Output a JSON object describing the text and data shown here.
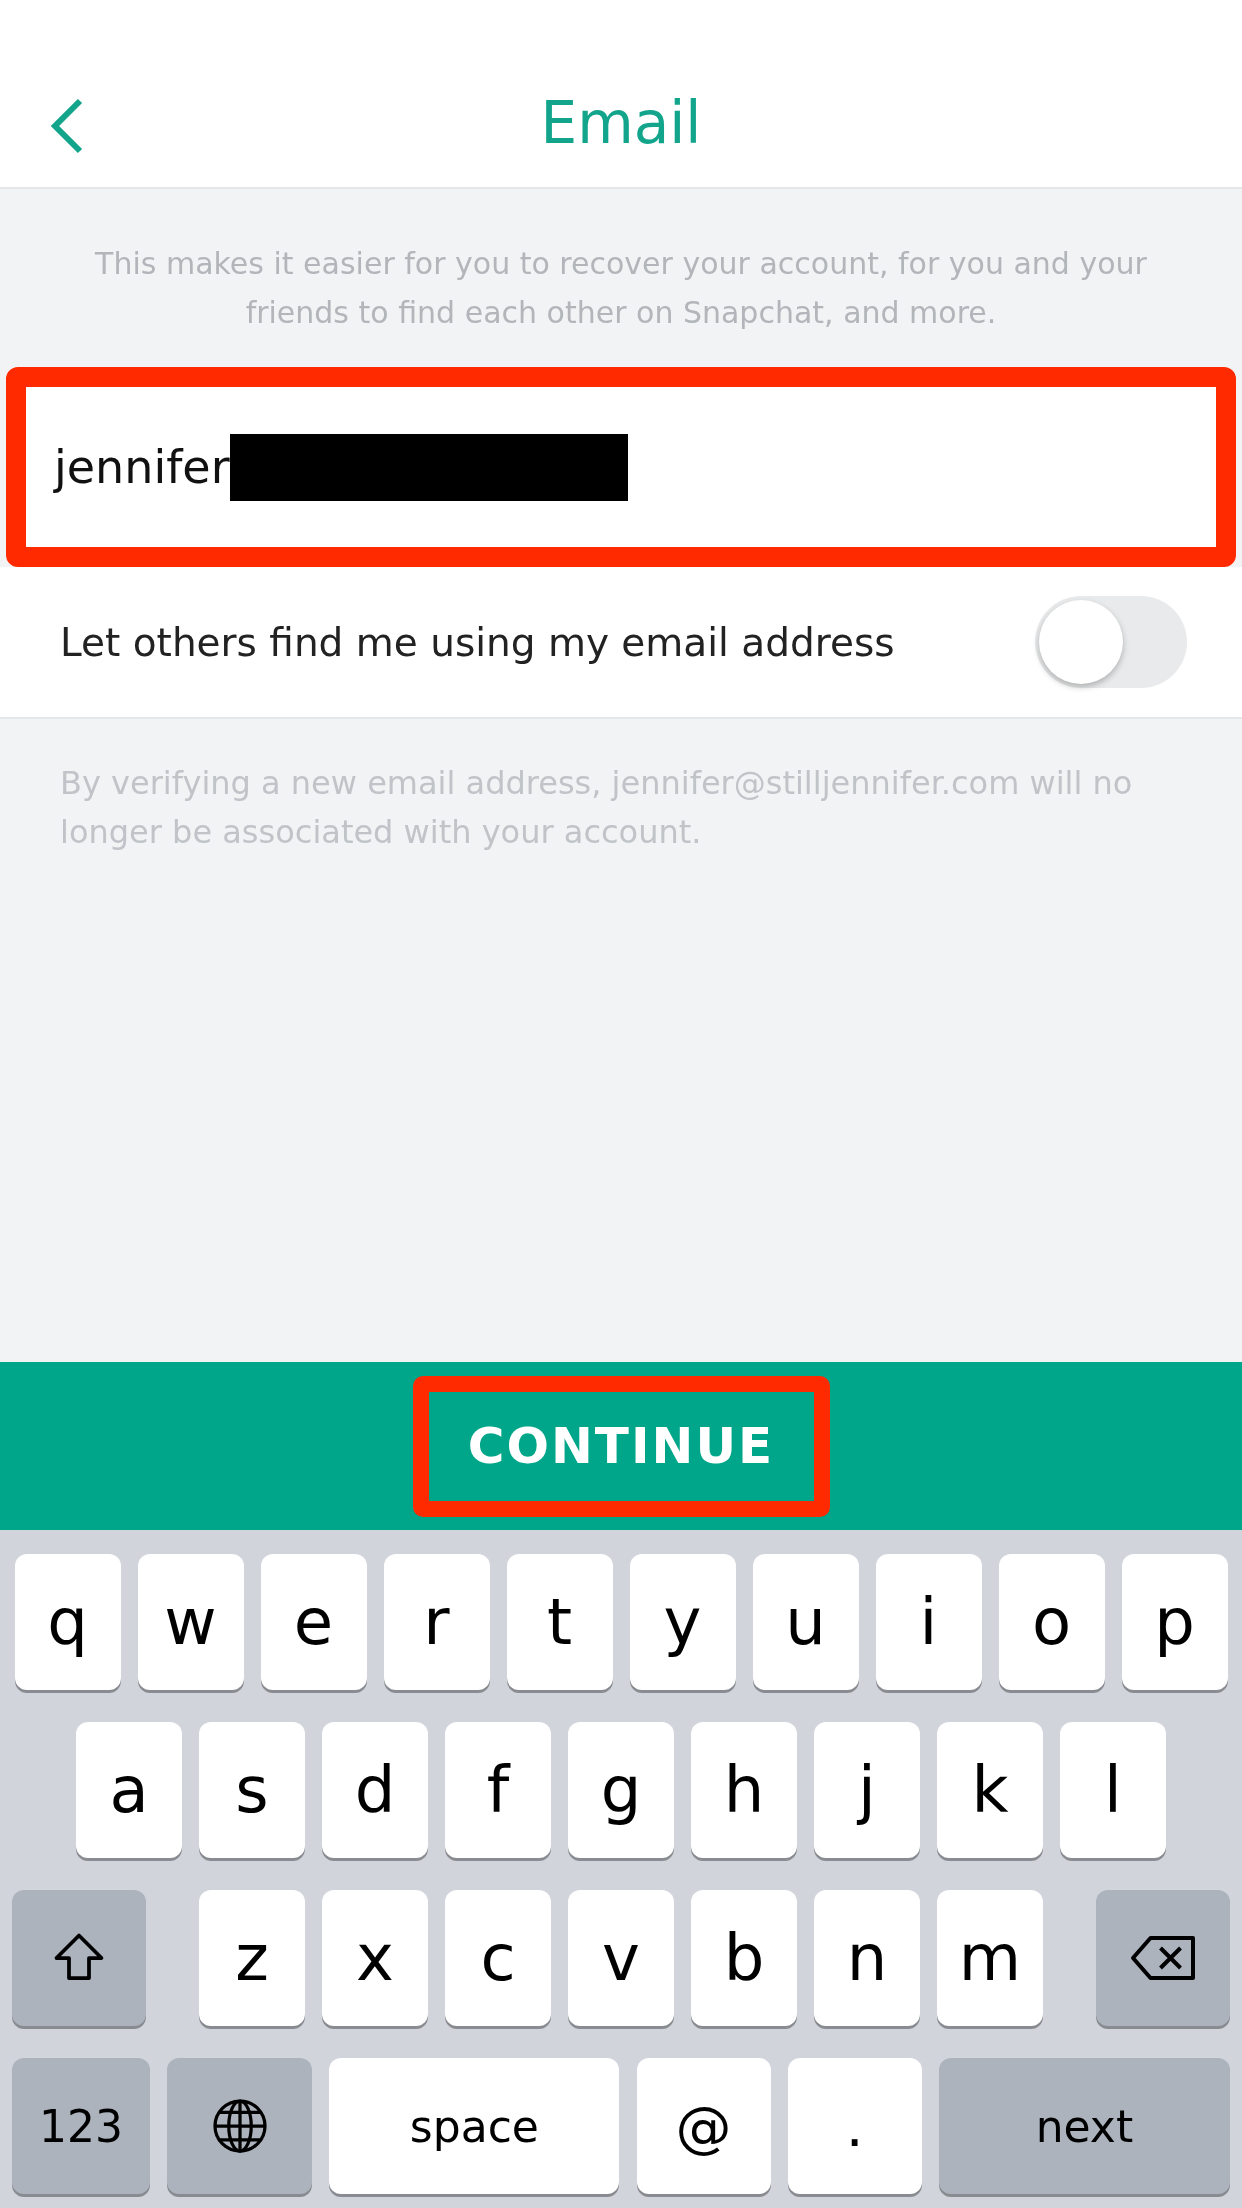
{
  "header": {
    "title": "Email"
  },
  "description": "This makes it easier for you to recover your account, for you and your friends to find each other on Snapchat, and more.",
  "email_field": {
    "value": "jennifer",
    "redacted": true,
    "highlighted": true
  },
  "discoverable": {
    "label": "Let others find me using my email address",
    "on": false
  },
  "note": "By verifying a new email address, jennifer@stilljennifer.com will no longer be associated with your account.",
  "continue_button": {
    "label": "CONTINUE",
    "highlighted": true
  },
  "keyboard": {
    "top_row": [
      {
        "kind": "letter",
        "label": "q"
      },
      {
        "kind": "letter",
        "label": "w"
      },
      {
        "kind": "letter",
        "label": "e"
      },
      {
        "kind": "letter",
        "label": "r"
      },
      {
        "kind": "letter",
        "label": "t"
      },
      {
        "kind": "letter",
        "label": "y"
      },
      {
        "kind": "letter",
        "label": "u"
      },
      {
        "kind": "letter",
        "label": "i"
      },
      {
        "kind": "letter",
        "label": "o"
      },
      {
        "kind": "letter",
        "label": "p"
      }
    ],
    "middle_row": [
      {
        "kind": "letter",
        "label": "a"
      },
      {
        "kind": "letter",
        "label": "s"
      },
      {
        "kind": "letter",
        "label": "d"
      },
      {
        "kind": "letter",
        "label": "f"
      },
      {
        "kind": "letter",
        "label": "g"
      },
      {
        "kind": "letter",
        "label": "h"
      },
      {
        "kind": "letter",
        "label": "j"
      },
      {
        "kind": "letter",
        "label": "k"
      },
      {
        "kind": "letter",
        "label": "l"
      }
    ],
    "bottom_row": [
      {
        "kind": "shift"
      },
      {
        "kind": "letter",
        "label": "z"
      },
      {
        "kind": "letter",
        "label": "x"
      },
      {
        "kind": "letter",
        "label": "c"
      },
      {
        "kind": "letter",
        "label": "v"
      },
      {
        "kind": "letter",
        "label": "b"
      },
      {
        "kind": "letter",
        "label": "n"
      },
      {
        "kind": "letter",
        "label": "m"
      },
      {
        "kind": "delete"
      }
    ],
    "function_row": [
      {
        "kind": "mode",
        "label": "123"
      },
      {
        "kind": "globe"
      },
      {
        "kind": "space",
        "label": "space"
      },
      {
        "kind": "symbol",
        "label": "@"
      },
      {
        "kind": "symbol",
        "label": "."
      },
      {
        "kind": "return",
        "label": "next"
      }
    ]
  }
}
